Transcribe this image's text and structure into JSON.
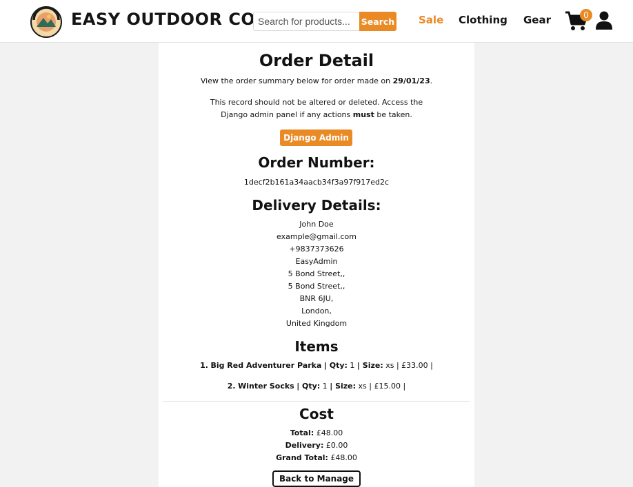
{
  "header": {
    "brand": "EASY OUTDOOR CO.",
    "search": {
      "placeholder": "Search for products...",
      "button_label": "Search"
    },
    "nav": {
      "sale": "Sale",
      "clothing": "Clothing",
      "gear": "Gear"
    },
    "cart_count": "0",
    "accent_color": "#ea8a25"
  },
  "order": {
    "title": "Order Detail",
    "summary_prefix": "View the order summary below for order made on ",
    "date": "29/01/23",
    "summary_suffix": ".",
    "notice_line1": "This record should not be altered or deleted. Access the",
    "notice_line2_prefix": "Django admin panel if any actions ",
    "notice_emphasis": "must",
    "notice_line2_suffix": " be taken.",
    "admin_button": "Django Admin",
    "number_heading": "Order Number:",
    "number": "1decf2b161a34aacb34f3a97f917ed2c",
    "delivery_heading": "Delivery Details:",
    "delivery": [
      "John Doe",
      "example@gmail.com",
      "+9837373626",
      "EasyAdmin",
      "5 Bond Street,,",
      "5 Bond Street,,",
      "BNR 6JU,",
      "London,",
      "United Kingdom"
    ],
    "items_heading": "Items",
    "items": [
      {
        "index": "1.",
        "name": "Big Red Adventurer Parka",
        "qty_label": "| Qty:",
        "qty": "1",
        "size_label": "| Size:",
        "size": "xs",
        "price": "| £33.00 |"
      },
      {
        "index": "2.",
        "name": "Winter Socks",
        "qty_label": "| Qty:",
        "qty": "1",
        "size_label": "| Size:",
        "size": "xs",
        "price": "| £15.00 |"
      }
    ],
    "cost_heading": "Cost",
    "total_label": "Total:",
    "total": "£48.00",
    "delivery_label": "Delivery:",
    "delivery_cost": "£0.00",
    "grand_label": "Grand Total:",
    "grand_total": "£48.00",
    "back_button": "Back to Manage"
  }
}
